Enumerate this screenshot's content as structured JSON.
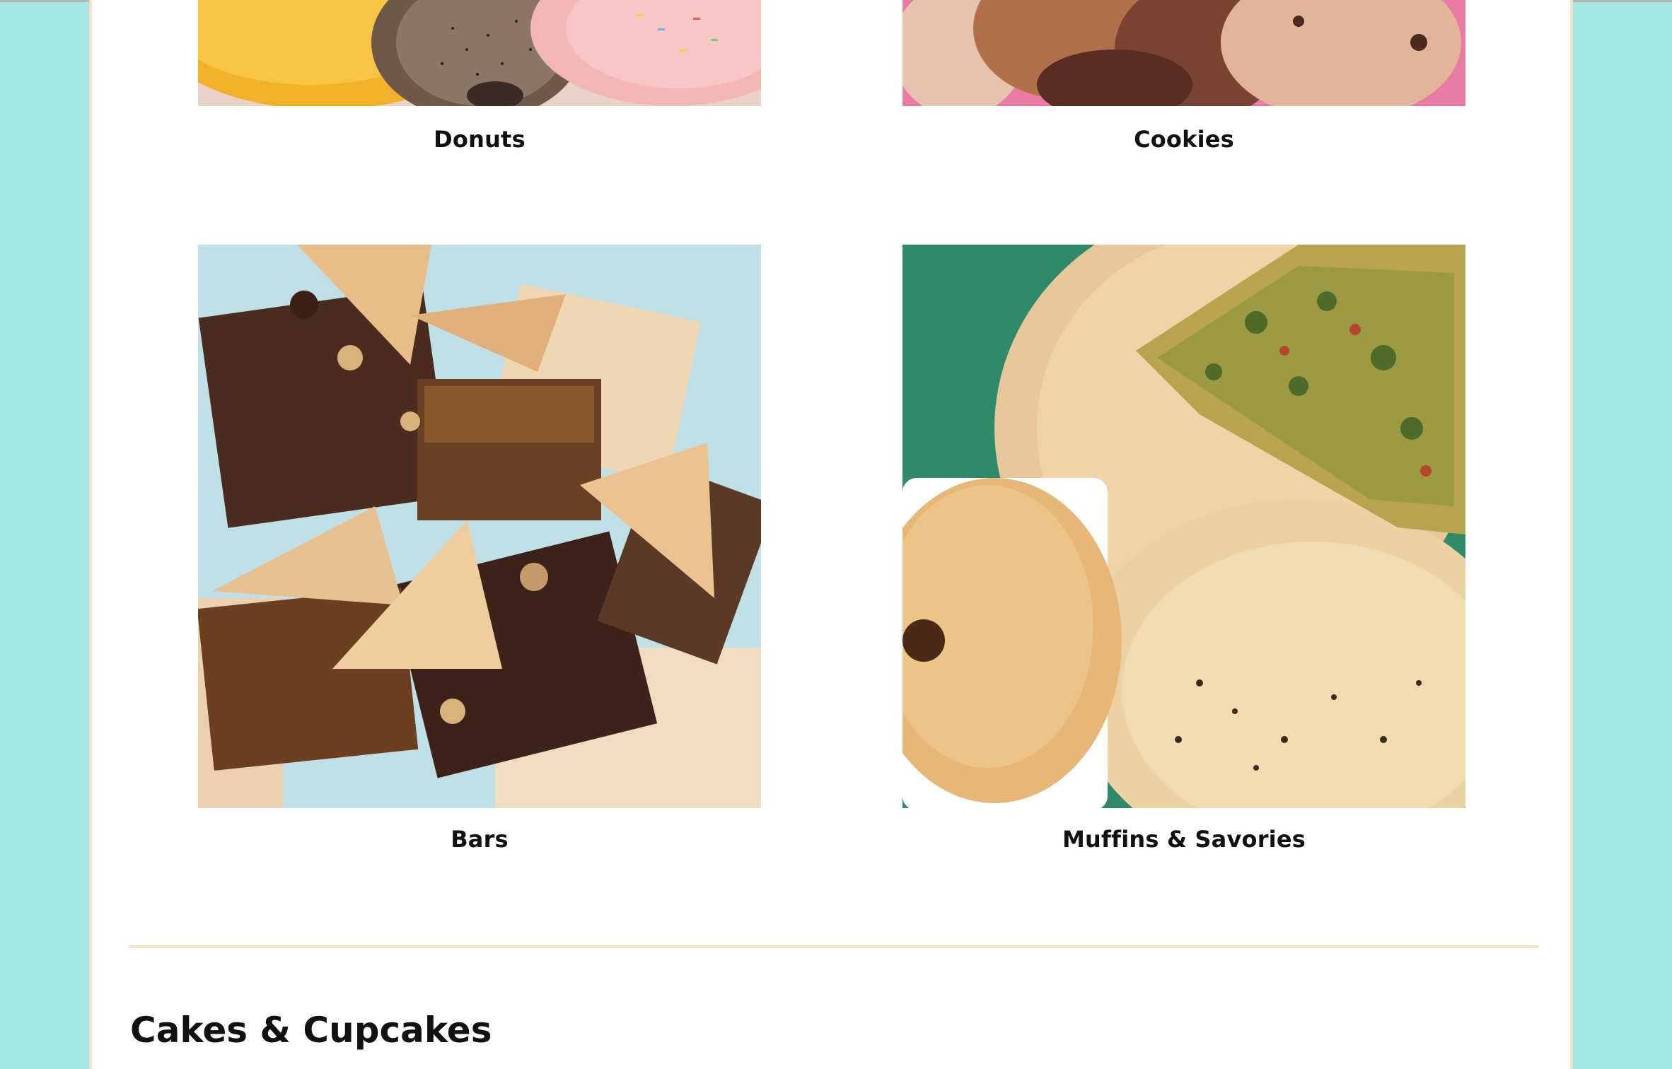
{
  "categories": [
    {
      "label": "Donuts"
    },
    {
      "label": "Cookies"
    },
    {
      "label": "Bars"
    },
    {
      "label": "Muffins & Savories"
    }
  ],
  "section": {
    "title": "Cakes & Cupcakes"
  }
}
